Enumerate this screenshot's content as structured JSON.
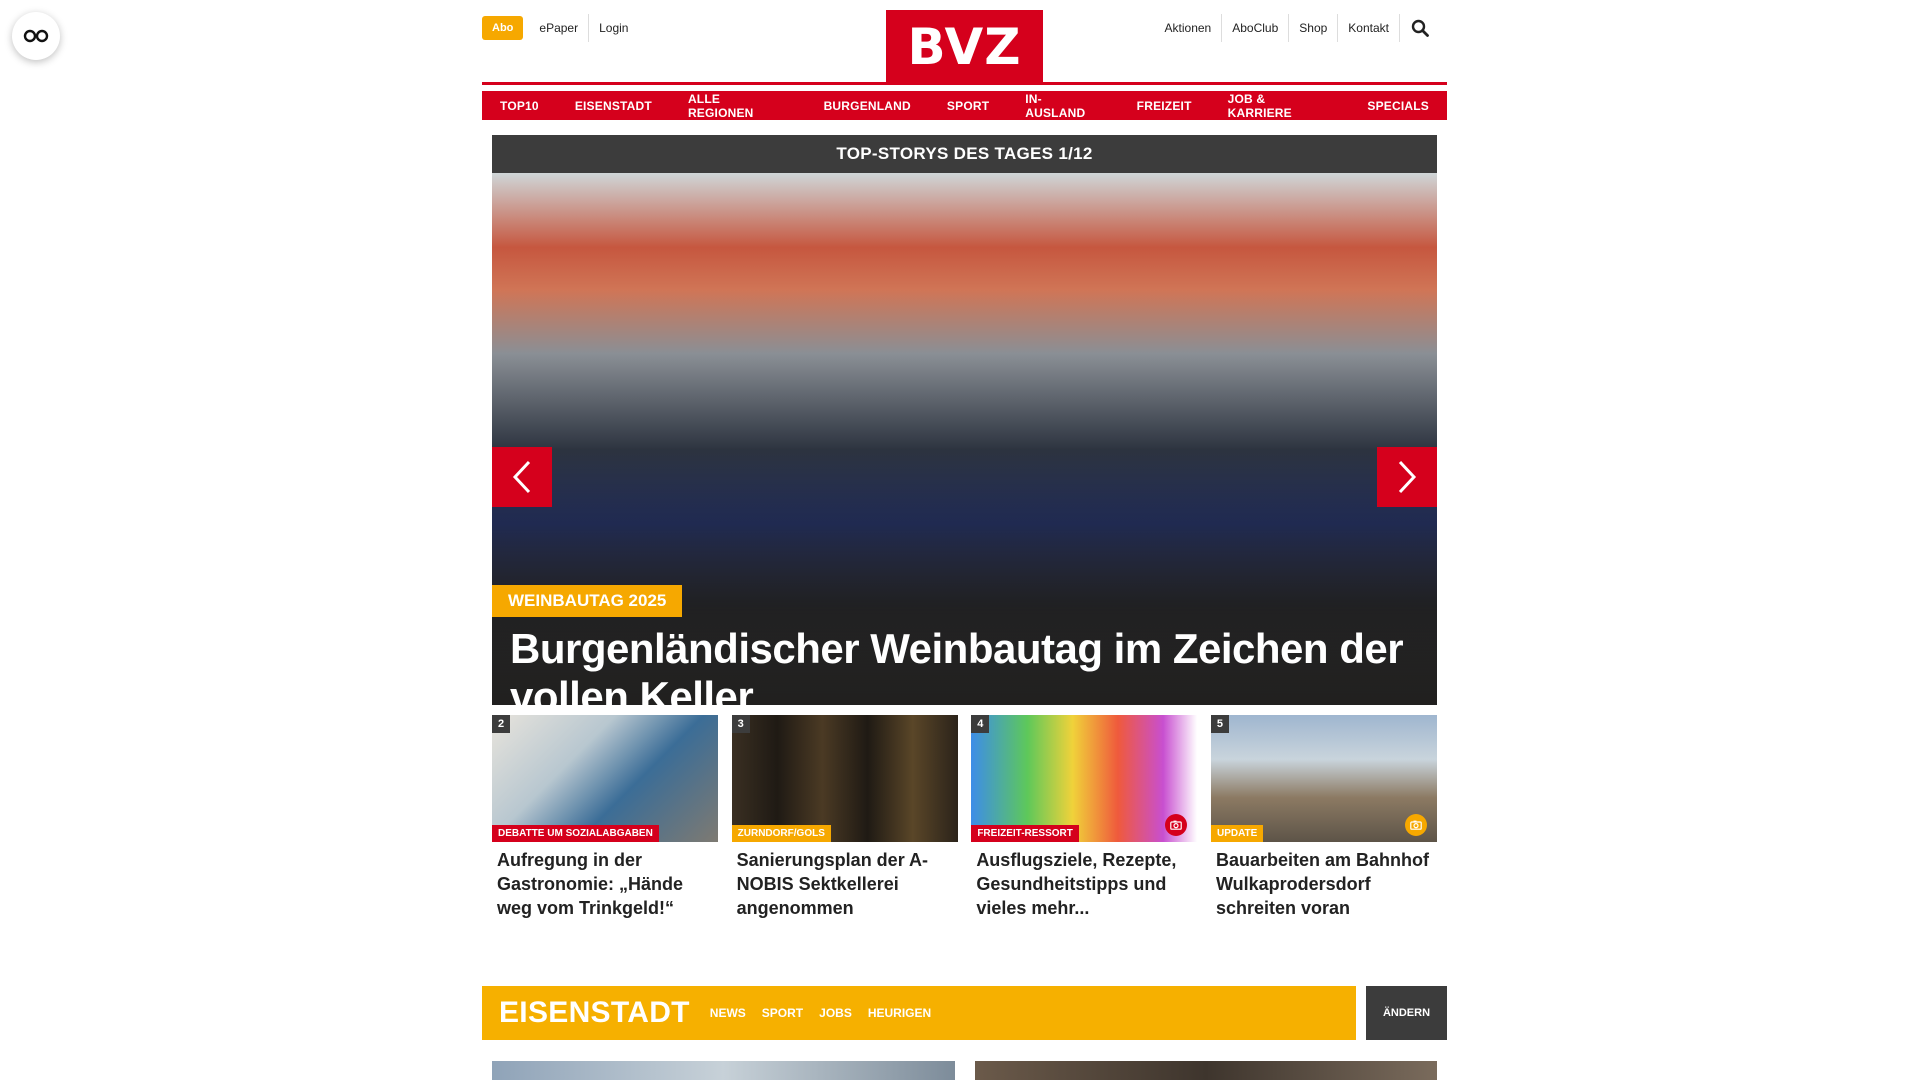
{
  "header": {
    "abo_label": "Abo",
    "left_links": [
      "ePaper",
      "Login"
    ],
    "logo_text": "BVZ",
    "right_links": [
      "Aktionen",
      "AboClub",
      "Shop",
      "Kontakt"
    ]
  },
  "nav": {
    "items": [
      "TOP10",
      "EISENSTADT",
      "ALLE REGIONEN",
      "BURGENLAND",
      "SPORT",
      "IN-AUSLAND",
      "FREIZEIT",
      "JOB & KARRIERE",
      "SPECIALS"
    ]
  },
  "slider": {
    "heading": "TOP-STORYS DES TAGES 1/12",
    "kicker": "WEINBAUTAG 2025",
    "headline": "Burgenländischer Weinbautag im Zeichen der vollen Keller"
  },
  "teasers": [
    {
      "number": "2",
      "tag": "DEBATTE UM SOZIALABGABEN",
      "title": "Aufregung in der Gastronomie: „Hände weg vom Trinkgeld!“"
    },
    {
      "number": "3",
      "tag": "ZURNDORF/GOLS",
      "title": "Sanierungsplan der A-NOBIS Sektkellerei angenommen"
    },
    {
      "number": "4",
      "tag": "FREIZEIT-RESSORT",
      "title": "Ausflugsziele, Rezepte, Gesundheitstipps und vieles mehr..."
    },
    {
      "number": "5",
      "tag": "UPDATE",
      "title": "Bauarbeiten am Bahnhof Wulkaprodersdorf schreiten voran"
    }
  ],
  "region": {
    "title": "EISENSTADT",
    "links": [
      "NEWS",
      "SPORT",
      "JOBS",
      "HEURIGEN"
    ],
    "change_label": "ÄNDERN"
  },
  "colors": {
    "brand_red": "#d5001c",
    "accent_yellow": "#f6a800",
    "dark_gray": "#3c3c3c"
  },
  "icons": [
    "accessibility-glasses-icon",
    "search-icon",
    "chevron-left-icon",
    "chevron-right-icon",
    "camera-icon"
  ]
}
